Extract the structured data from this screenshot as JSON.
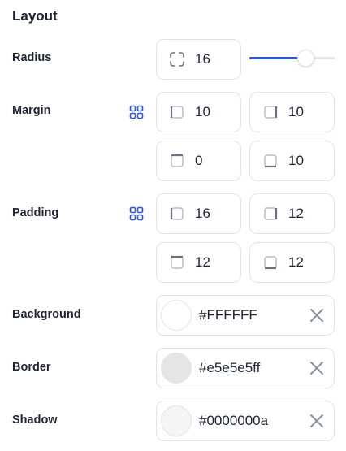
{
  "section_title": "Layout",
  "radius": {
    "label": "Radius",
    "value": "16",
    "slider_fraction": 0.66
  },
  "margin": {
    "label": "Margin",
    "left": "10",
    "right": "10",
    "top": "0",
    "bottom": "10"
  },
  "padding": {
    "label": "Padding",
    "left": "16",
    "right": "12",
    "top": "12",
    "bottom": "12"
  },
  "background": {
    "label": "Background",
    "value": "#FFFFFF",
    "swatch": "#ffffff"
  },
  "border": {
    "label": "Border",
    "value": "#e5e5e5ff",
    "swatch": "#e5e5e5"
  },
  "shadow": {
    "label": "Shadow",
    "value": "#0000000a",
    "swatch": "#f5f5f5"
  },
  "colors": {
    "accent": "#2f55d4",
    "field_border": "#e1e3e8",
    "icon": "#6b7180"
  },
  "icons": {
    "radius": "corner-radius-icon",
    "link": "link-sides-icon",
    "left": "side-left-icon",
    "right": "side-right-icon",
    "top": "side-top-icon",
    "bottom": "side-bottom-icon",
    "clear": "close-icon"
  }
}
